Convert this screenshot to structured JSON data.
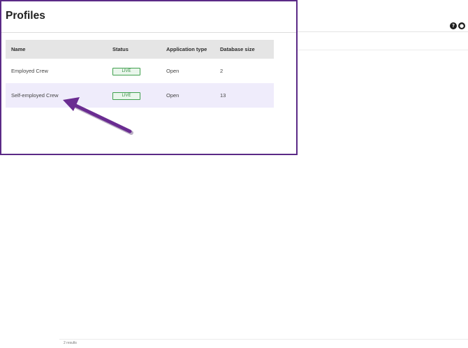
{
  "header": {
    "help_icon_glyph": "?",
    "user_icon_glyph": "●"
  },
  "panel": {
    "title": "Profiles"
  },
  "table": {
    "columns": {
      "name": "Name",
      "status": "Status",
      "application_type": "Application type",
      "database_size": "Database size"
    },
    "rows": [
      {
        "name": "Employed Crew",
        "status": "LIVE",
        "application_type": "Open",
        "database_size": "2"
      },
      {
        "name": "Self-employed Crew",
        "status": "LIVE",
        "application_type": "Open",
        "database_size": "13"
      }
    ],
    "selected_row": 1
  },
  "footer": {
    "results_count": "2 results"
  },
  "colors": {
    "panel_border": "#5b2a86",
    "arrow": "#6a2c91",
    "live_badge": "#3fa04d",
    "selected_row_bg": "#efecfb"
  },
  "icons": [
    "help-icon",
    "user-circle-icon",
    "annotation-arrow"
  ]
}
